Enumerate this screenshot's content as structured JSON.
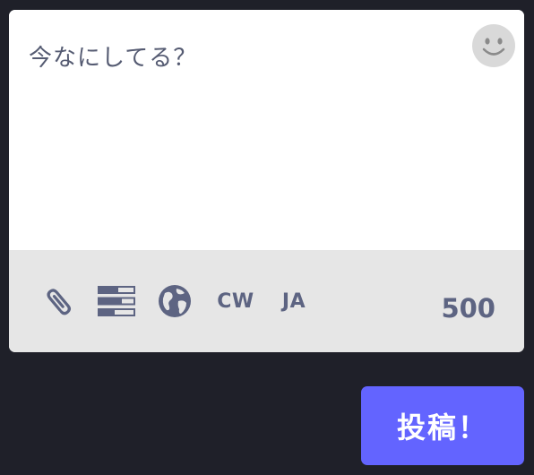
{
  "compose": {
    "placeholder": "今なにしてる？",
    "value": ""
  },
  "emoji": {
    "icon": "smiley-icon"
  },
  "toolbar": {
    "attach_icon": "paperclip-icon",
    "poll_icon": "poll-icon",
    "privacy_icon": "globe-icon",
    "cw_label": "CW",
    "language_label": "JA",
    "character_count": "500"
  },
  "publish": {
    "label": "投稿！"
  },
  "colors": {
    "page_background": "#1f2029",
    "composer_background": "#ffffff",
    "toolbar_background": "#e6e6e6",
    "icon_color": "#5d6482",
    "publish_button": "#6364ff",
    "publish_text": "#ffffff"
  }
}
